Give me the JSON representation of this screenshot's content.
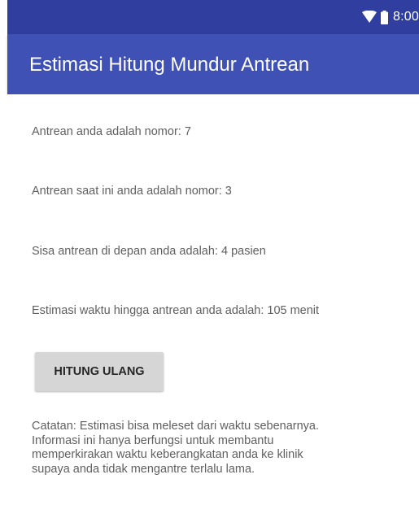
{
  "status_bar": {
    "time": "8:00",
    "icons": [
      "wifi-icon",
      "battery-icon"
    ],
    "color": "#303f9f"
  },
  "app_bar": {
    "title": "Estimasi Hitung Mundur Antrean",
    "color": "#3f51b5"
  },
  "content": {
    "your_queue": "Antrean anda adalah nomor: 7",
    "current_queue": "Antrean saat ini anda adalah nomor: 3",
    "remaining": "Sisa antrean di depan anda adalah: 4 pasien",
    "estimate": "Estimasi waktu hingga antrean anda adalah: 105 menit",
    "button_label": "HITUNG ULANG",
    "note_lines": [
      "Catatan: Estimasi bisa meleset dari waktu sebenarnya.",
      "Informasi ini hanya berfungsi untuk membantu",
      "memperkirakan waktu keberangkatan anda ke klinik",
      "supaya anda tidak mengantre terlalu lama."
    ]
  }
}
